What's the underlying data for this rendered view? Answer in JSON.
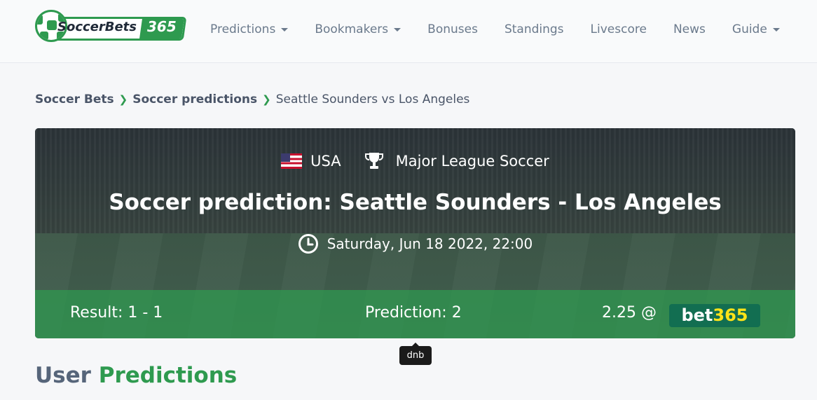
{
  "logo": {
    "text_main": "SoccerBets",
    "text_num": "365"
  },
  "nav": [
    {
      "label": "Predictions",
      "dropdown": true
    },
    {
      "label": "Bookmakers",
      "dropdown": true
    },
    {
      "label": "Bonuses",
      "dropdown": false
    },
    {
      "label": "Standings",
      "dropdown": false
    },
    {
      "label": "Livescore",
      "dropdown": false
    },
    {
      "label": "News",
      "dropdown": false
    },
    {
      "label": "Guide",
      "dropdown": true
    }
  ],
  "breadcrumb": {
    "items": [
      "Soccer Bets",
      "Soccer predictions"
    ],
    "current": "Seattle Sounders vs Los Angeles"
  },
  "match": {
    "country": "USA",
    "league": "Major League Soccer",
    "title": "Soccer prediction: Seattle Sounders - Los Angeles",
    "datetime": "Saturday, Jun 18 2022, 22:00",
    "result": "Result: 1 - 1",
    "prediction": "Prediction: 2",
    "odds": "2.25 @",
    "bookmaker_a": "bet",
    "bookmaker_b": "365",
    "tooltip": "dnb"
  },
  "section": {
    "title_a": "User",
    "title_b": "Predictions"
  },
  "colors": {
    "accent": "#2e9a4f",
    "bookmaker_bg": "#126e51",
    "bookmaker_highlight": "#ffe418"
  }
}
